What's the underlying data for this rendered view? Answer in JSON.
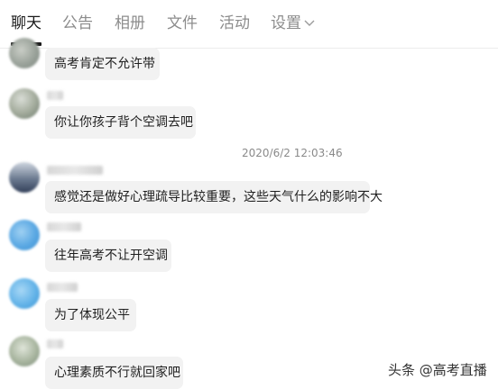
{
  "tabs": [
    {
      "label": "聊天",
      "active": true
    },
    {
      "label": "公告",
      "active": false
    },
    {
      "label": "相册",
      "active": false
    },
    {
      "label": "文件",
      "active": false
    },
    {
      "label": "活动",
      "active": false
    },
    {
      "label": "设置",
      "active": false
    }
  ],
  "messages": [
    {
      "text": "高考肯定不允许带"
    },
    {
      "text": "你让你孩子背个空调去吧"
    },
    {
      "text": "感觉还是做好心理疏导比较重要，这些天气什么的影响不大"
    },
    {
      "text": "往年高考不让开空调"
    },
    {
      "text": "为了体现公平"
    },
    {
      "text": "心理素质不行就回家吧"
    }
  ],
  "timestamp": "2020/6/2 12:03:46",
  "watermark": "头条 @高考直播",
  "colors": {
    "bubble": "#f2f2f2",
    "active_tab": "#1a1a1a",
    "inactive_tab": "#8c8c8c"
  }
}
